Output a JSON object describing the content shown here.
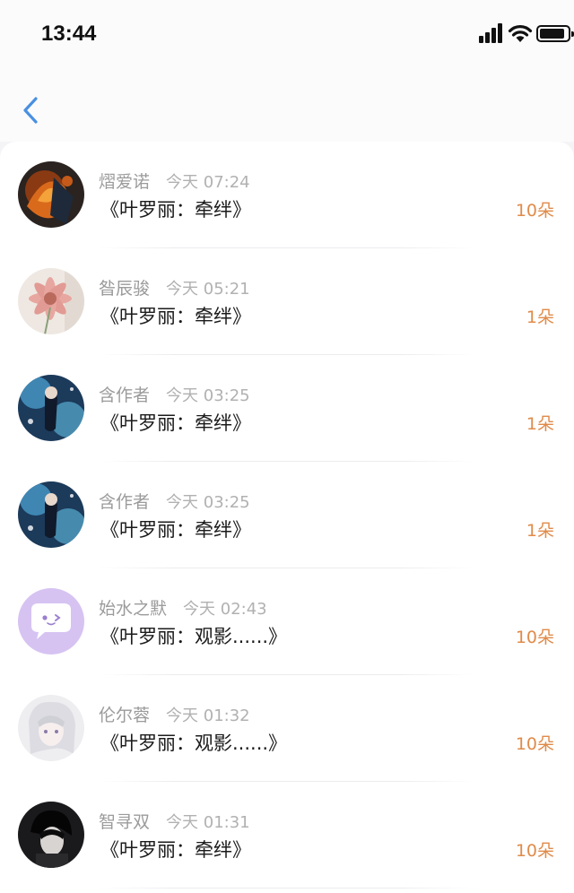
{
  "status_bar": {
    "time": "13:44"
  },
  "icons": {
    "signal": "signal-icon",
    "wifi": "wifi-icon",
    "battery": "battery-icon",
    "back": "chevron-left-icon"
  },
  "colors": {
    "accent": "#4a90e2",
    "amount": "#e08b4a",
    "name": "#9b9b9b"
  },
  "items": [
    {
      "name": "熠爱诺",
      "time": "今天 07:24",
      "title": "《叶罗丽：牵绊》",
      "amount": "10朵",
      "avatar": "dark-fire-figure"
    },
    {
      "name": "昝辰骏",
      "time": "今天 05:21",
      "title": "《叶罗丽：牵绊》",
      "amount": "1朵",
      "avatar": "pink-flower"
    },
    {
      "name": "含作者",
      "time": "今天 03:25",
      "title": "《叶罗丽：牵绊》",
      "amount": "1朵",
      "avatar": "blue-sparkle-figure"
    },
    {
      "name": "含作者",
      "time": "今天 03:25",
      "title": "《叶罗丽：牵绊》",
      "amount": "1朵",
      "avatar": "blue-sparkle-figure"
    },
    {
      "name": "始水之默",
      "time": "今天 02:43",
      "title": "《叶罗丽：观影......》",
      "amount": "10朵",
      "avatar": "purple-chat-bubble"
    },
    {
      "name": "伦尔蓉",
      "time": "今天 01:32",
      "title": "《叶罗丽：观影......》",
      "amount": "10朵",
      "avatar": "white-hair-girl"
    },
    {
      "name": "智寻双",
      "time": "今天 01:31",
      "title": "《叶罗丽：牵绊》",
      "amount": "10朵",
      "avatar": "dark-hair-boy"
    }
  ]
}
